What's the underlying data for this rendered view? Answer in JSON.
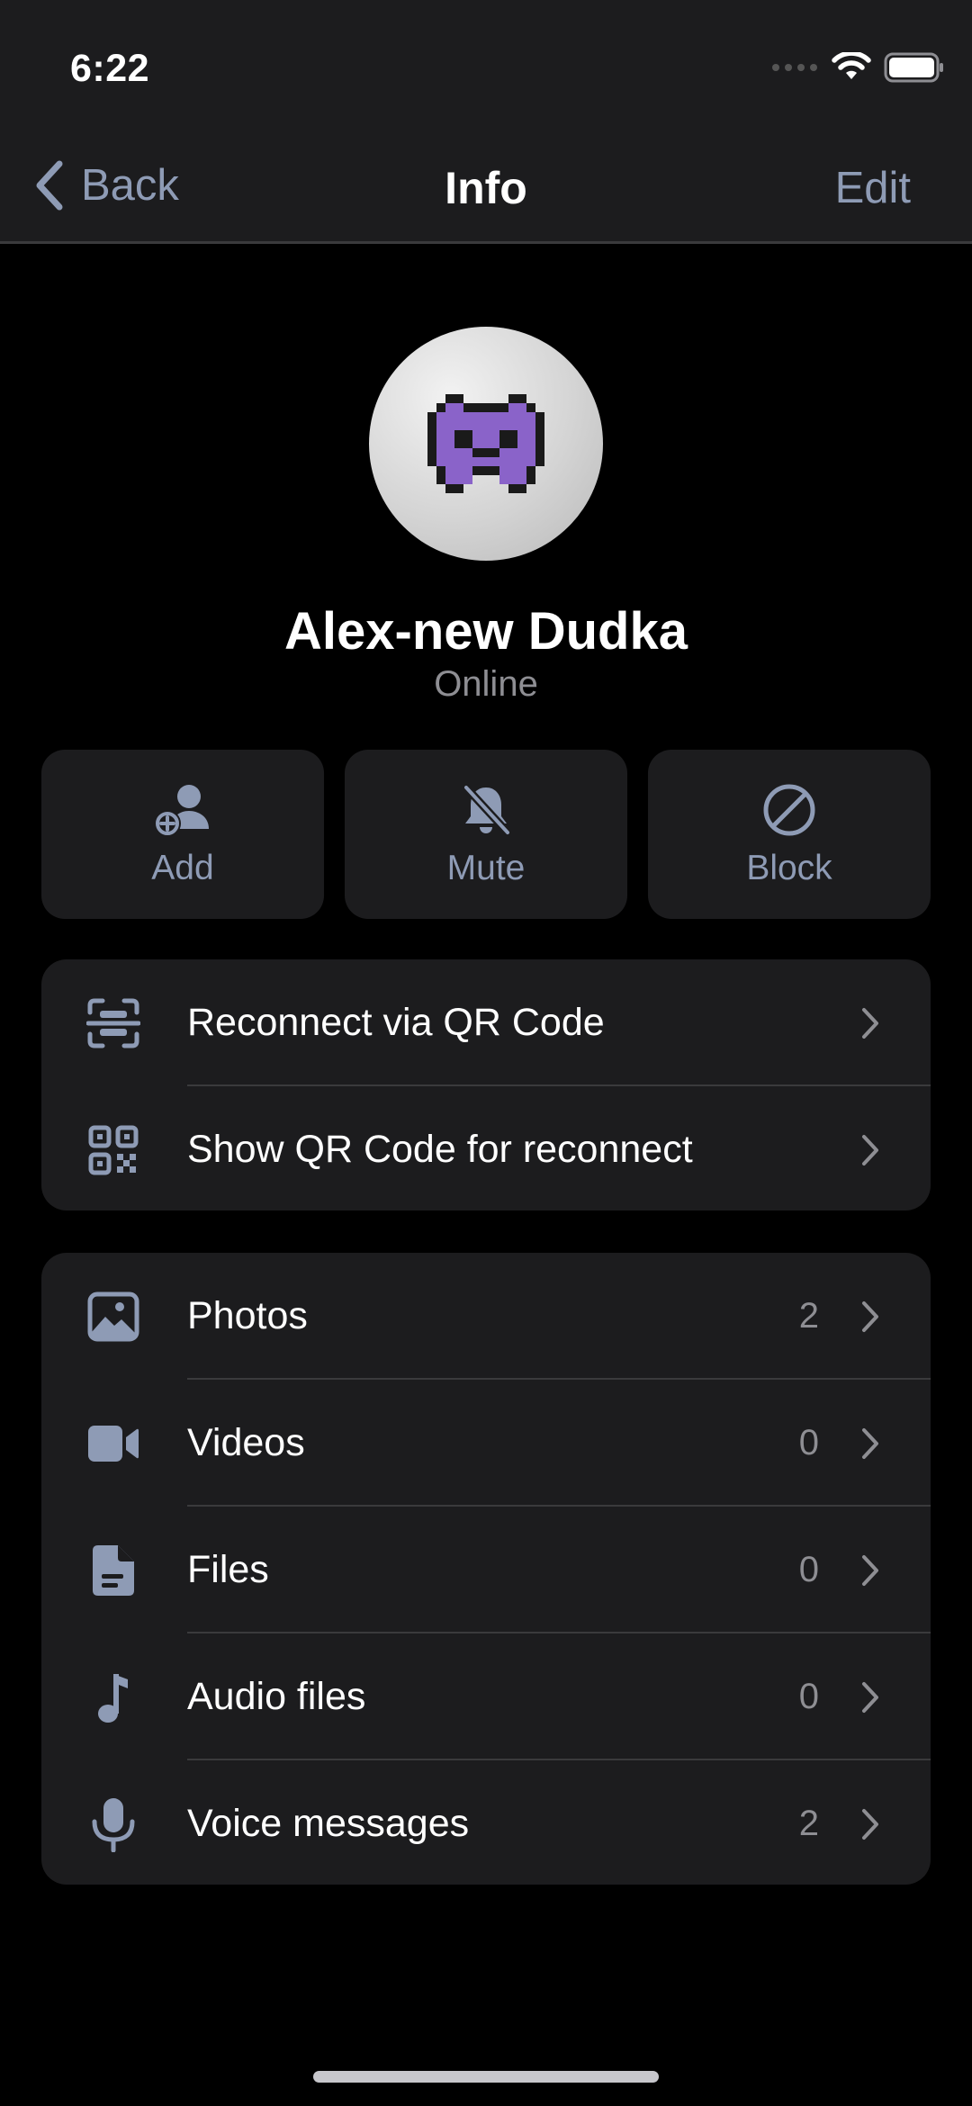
{
  "status_bar": {
    "time": "6:22"
  },
  "nav": {
    "back_label": "Back",
    "title": "Info",
    "edit_label": "Edit"
  },
  "profile": {
    "avatar_icon": "alien-monster-emoji",
    "name": "Alex-new Dudka",
    "status": "Online"
  },
  "actions": [
    {
      "label": "Add",
      "icon": "add-contact-icon"
    },
    {
      "label": "Mute",
      "icon": "bell-slash-icon"
    },
    {
      "label": "Block",
      "icon": "block-icon"
    }
  ],
  "qr_section": [
    {
      "label": "Reconnect via QR Code",
      "icon": "qr-scan-icon"
    },
    {
      "label": "Show QR Code for reconnect",
      "icon": "qr-code-icon"
    }
  ],
  "media_section": [
    {
      "label": "Photos",
      "count": "2",
      "icon": "photo-icon"
    },
    {
      "label": "Videos",
      "count": "0",
      "icon": "video-icon"
    },
    {
      "label": "Files",
      "count": "0",
      "icon": "file-icon"
    },
    {
      "label": "Audio files",
      "count": "0",
      "icon": "music-note-icon"
    },
    {
      "label": "Voice messages",
      "count": "2",
      "icon": "microphone-icon"
    }
  ],
  "colors": {
    "background": "#000000",
    "surface": "#1c1c1e",
    "accent": "#8e9bb5",
    "secondary_text": "#8e8e93"
  }
}
